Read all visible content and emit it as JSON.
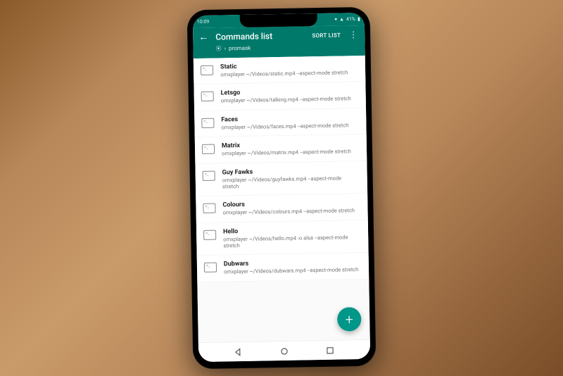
{
  "status": {
    "time": "10:09",
    "battery": "41%"
  },
  "appbar": {
    "title": "Commands list",
    "sort_label": "SORT LIST",
    "breadcrumb_host": "promask"
  },
  "fab": {
    "label": "+"
  },
  "items": [
    {
      "title": "Static",
      "cmd": "omxplayer ~/Videos/static.mp4 --aspect-mode stretch"
    },
    {
      "title": "Letsgo",
      "cmd": "omxplayer ~/Videos/talking.mp4 --aspect-mode stretch"
    },
    {
      "title": "Faces",
      "cmd": "omxplayer ~/Videos/faces.mp4 --aspect-mode stretch"
    },
    {
      "title": "Matrix",
      "cmd": "omxplayer ~/Videos/matrix.mp4 --aspect-mode stretch"
    },
    {
      "title": "Guy Fawks",
      "cmd": "omxplayer ~/Videos/guyfawks.mp4 --aspect-mode stretch"
    },
    {
      "title": "Colours",
      "cmd": "omxplayer ~/Videos/colours.mp4 --aspect-mode stretch"
    },
    {
      "title": "Hello",
      "cmd": "omxplayer ~/Videos/hello.mp4 -o alsa --aspect-mode stretch"
    },
    {
      "title": "Dubwars",
      "cmd": "omxplayer ~/Videos/dubwars.mp4 --aspect-mode stretch"
    }
  ]
}
